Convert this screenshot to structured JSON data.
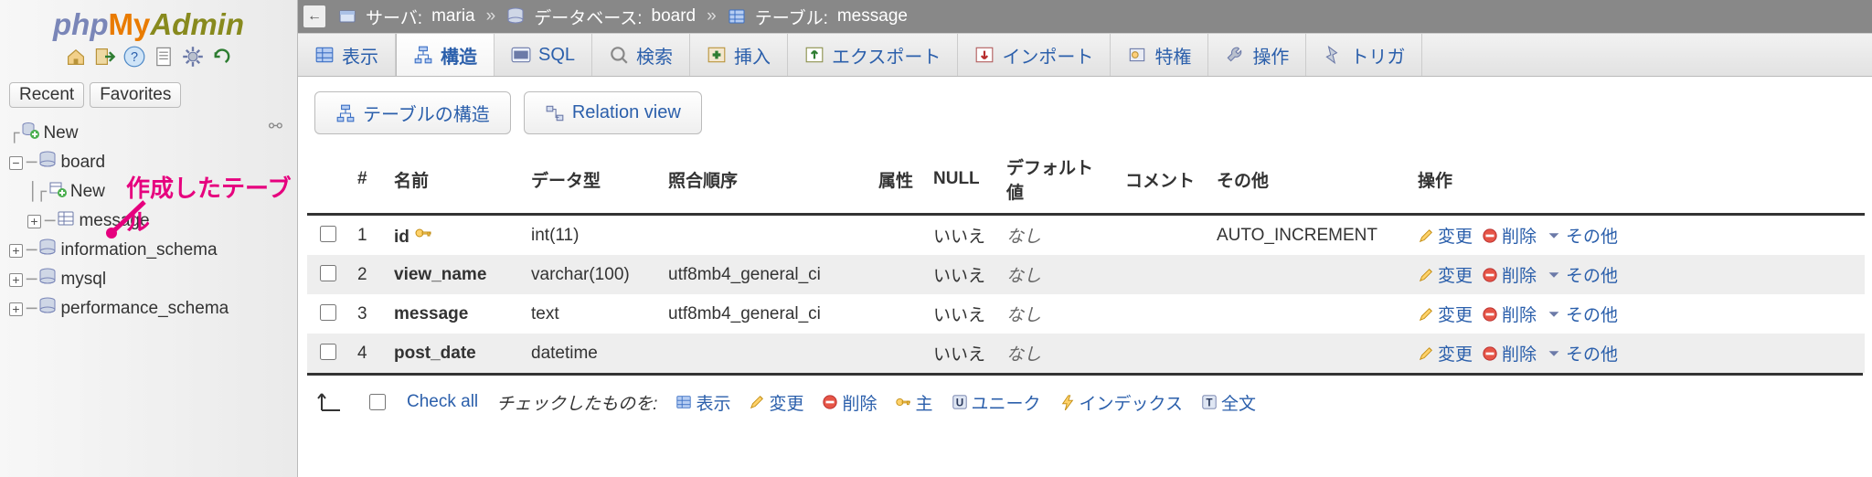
{
  "sidebar": {
    "logo_parts": [
      "php",
      "My",
      "Admin"
    ],
    "recent_btn": "Recent",
    "fav_btn": "Favorites",
    "annotation": "作成したテーブル",
    "tree": {
      "new_top": "New",
      "db_board": "board",
      "board_new": "New",
      "board_message": "message",
      "info_schema": "information_schema",
      "mysql": "mysql",
      "perf_schema": "performance_schema"
    }
  },
  "breadcrumb": {
    "server_label": "サーバ:",
    "server": "maria",
    "db_label": "データベース:",
    "db": "board",
    "table_label": "テーブル:",
    "table": "message"
  },
  "tabs": {
    "browse": "表示",
    "structure": "構造",
    "sql": "SQL",
    "search": "検索",
    "insert": "挿入",
    "export": "エクスポート",
    "import": "インポート",
    "privileges": "特権",
    "operations": "操作",
    "triggers": "トリガ"
  },
  "subtabs": {
    "structure": "テーブルの構造",
    "relation": "Relation view"
  },
  "table": {
    "headers": {
      "num": "#",
      "name": "名前",
      "type": "データ型",
      "collation": "照合順序",
      "attr": "属性",
      "null": "NULL",
      "default": "デフォルト値",
      "comment": "コメント",
      "extra": "その他",
      "ops": "操作"
    },
    "rows": [
      {
        "num": "1",
        "name": "id",
        "key": true,
        "type": "int(11)",
        "collation": "",
        "attr": "",
        "null": "いいえ",
        "default": "なし",
        "comment": "",
        "extra": "AUTO_INCREMENT"
      },
      {
        "num": "2",
        "name": "view_name",
        "key": false,
        "type": "varchar(100)",
        "collation": "utf8mb4_general_ci",
        "attr": "",
        "null": "いいえ",
        "default": "なし",
        "comment": "",
        "extra": ""
      },
      {
        "num": "3",
        "name": "message",
        "key": false,
        "type": "text",
        "collation": "utf8mb4_general_ci",
        "attr": "",
        "null": "いいえ",
        "default": "なし",
        "comment": "",
        "extra": ""
      },
      {
        "num": "4",
        "name": "post_date",
        "key": false,
        "type": "datetime",
        "collation": "",
        "attr": "",
        "null": "いいえ",
        "default": "なし",
        "comment": "",
        "extra": ""
      }
    ],
    "ops": {
      "edit": "変更",
      "drop": "削除",
      "more": "その他"
    }
  },
  "footer": {
    "check_all": "Check all",
    "with_selected": "チェックしたものを:",
    "browse": "表示",
    "edit": "変更",
    "drop": "削除",
    "primary": "主",
    "unique": "ユニーク",
    "index": "インデックス",
    "fulltext": "全文"
  }
}
